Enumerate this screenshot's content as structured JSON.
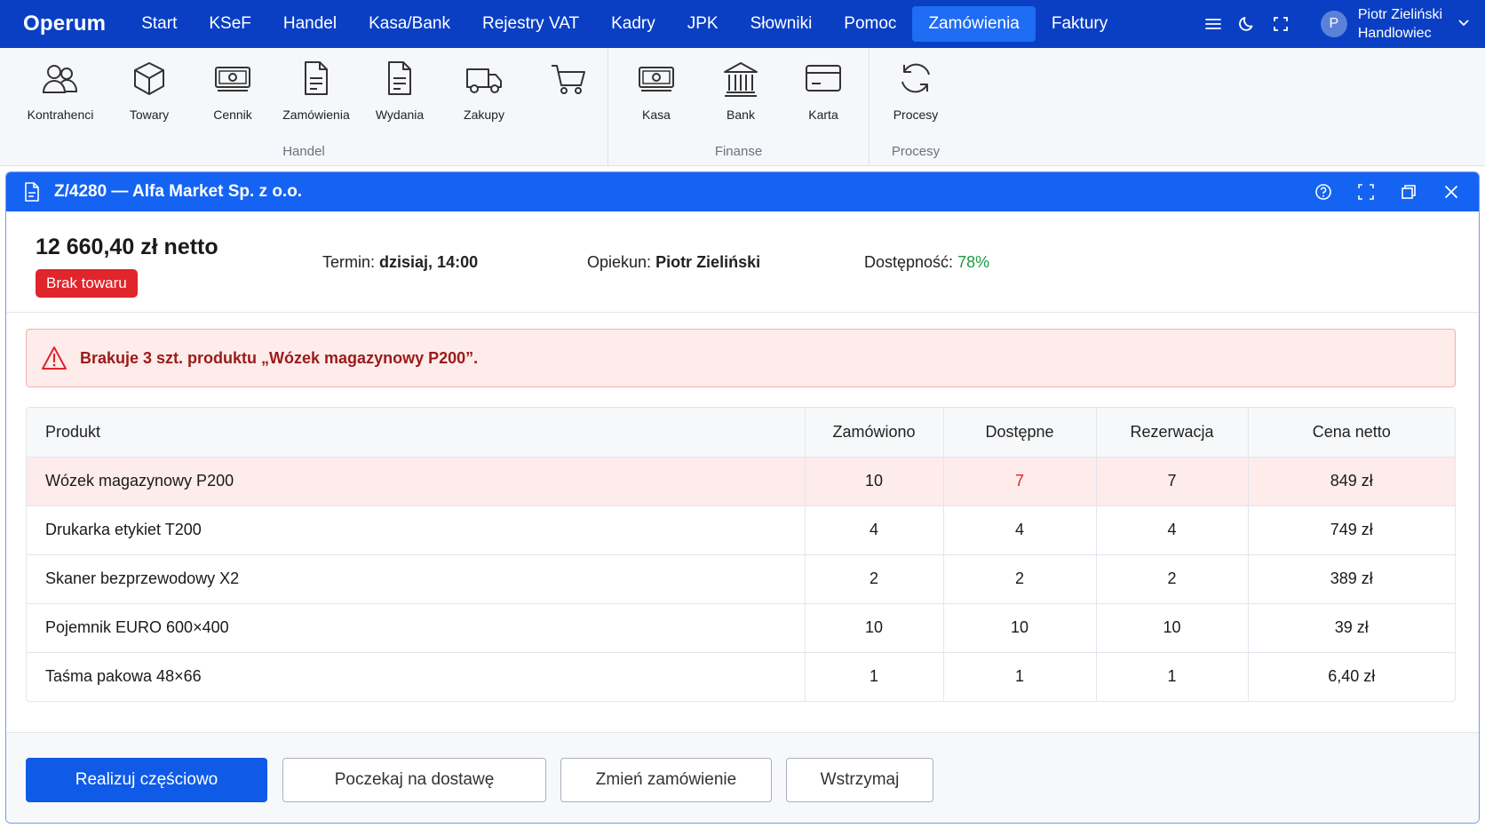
{
  "app": {
    "brand": "Operum",
    "nav": [
      "Start",
      "KSeF",
      "Handel",
      "Kasa/Bank",
      "Rejestry VAT",
      "Kadry",
      "JPK",
      "Słowniki",
      "Pomoc",
      "Zamówienia",
      "Faktury"
    ],
    "active_nav": "Zamówienia",
    "user": {
      "initial": "P",
      "name": "Piotr Zieliński",
      "role": "Handlowiec"
    }
  },
  "ribbon": {
    "groups": [
      {
        "label": "Handel",
        "items": [
          "Kontrahenci",
          "Towary",
          "Cennik",
          "Zamówienia",
          "Wydania",
          "Zakupy",
          ""
        ]
      },
      {
        "label": "Finanse",
        "items": [
          "Kasa",
          "Bank",
          "Karta"
        ]
      },
      {
        "label": "Procesy",
        "items": [
          "Procesy"
        ]
      }
    ]
  },
  "dialog": {
    "title": "Z/4280 — Alfa Market Sp. z o.o.",
    "amount": "12 660,40 zł netto",
    "badge": "Brak towaru",
    "termin_label": "Termin:",
    "termin_value": "dzisiaj, 14:00",
    "opiekun_label": "Opiekun:",
    "opiekun_value": "Piotr Zieliński",
    "dostepnosc_label": "Dostępność:",
    "dostepnosc_value": "78%",
    "alert": "Brakuje 3 szt. produktu „Wózek magazynowy P200”.",
    "columns": [
      "Produkt",
      "Zamówiono",
      "Dostępne",
      "Rezerwacja",
      "Cena netto"
    ],
    "rows": [
      {
        "product": "Wózek magazynowy P200",
        "ordered": "10",
        "available": "7",
        "reserved": "7",
        "price": "849 zł"
      },
      {
        "product": "Drukarka etykiet T200",
        "ordered": "4",
        "available": "4",
        "reserved": "4",
        "price": "749 zł"
      },
      {
        "product": "Skaner bezprzewodowy X2",
        "ordered": "2",
        "available": "2",
        "reserved": "2",
        "price": "389 zł"
      },
      {
        "product": "Pojemnik EURO 600×400",
        "ordered": "10",
        "available": "10",
        "reserved": "10",
        "price": "39 zł"
      },
      {
        "product": "Taśma pakowa 48×66",
        "ordered": "1",
        "available": "1",
        "reserved": "1",
        "price": "6,40 zł"
      }
    ],
    "buttons": {
      "partial": "Realizuj częściowo",
      "wait": "Poczekaj na dostawę",
      "change": "Zmień zamówienie",
      "hold": "Wstrzymaj"
    }
  },
  "colors": {
    "topbar": "#0a3fc4",
    "active_tab": "#1f6cf5",
    "dialog_title": "#1463f3",
    "danger": "#e0252b",
    "success": "#1c9a44"
  }
}
